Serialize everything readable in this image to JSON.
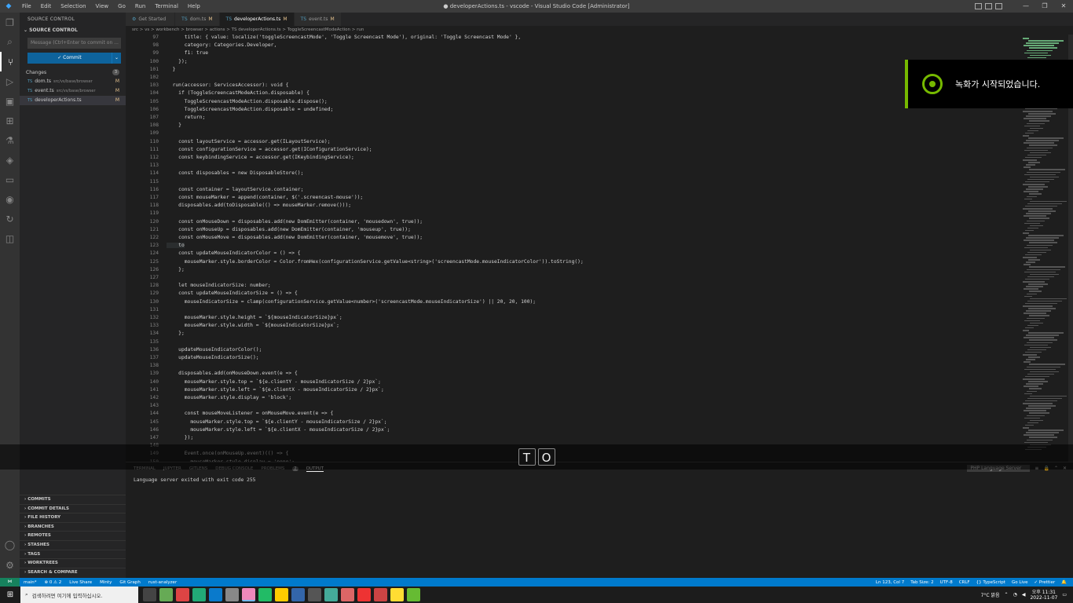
{
  "titlebar": {
    "menu": [
      "File",
      "Edit",
      "Selection",
      "View",
      "Go",
      "Run",
      "Terminal",
      "Help"
    ],
    "title": "● developerActions.ts - vscode - Visual Studio Code [Administrator]",
    "controls": [
      "—",
      "❐",
      "✕"
    ]
  },
  "activity_icons": [
    "files-icon",
    "search-icon",
    "source-control-icon",
    "run-debug-icon",
    "remote-explorer-icon",
    "extensions-icon",
    "testing-icon",
    "python-icon",
    "terminal-icon",
    "gitlens-icon",
    "live-share-icon",
    "browser-icon"
  ],
  "sidebar": {
    "header": "SOURCE CONTROL",
    "section": "SOURCE CONTROL",
    "commit_placeholder": "Message (Ctrl+Enter to commit on ...",
    "commit_label": "✓ Commit",
    "changes_label": "Changes",
    "changes_count": "3",
    "files": [
      {
        "name": "dom.ts",
        "dir": "src/vs/base/browser",
        "status": "M"
      },
      {
        "name": "event.ts",
        "dir": "src/vs/base/browser",
        "status": "M"
      },
      {
        "name": "developerActions.ts",
        "dir": "",
        "status": "M"
      }
    ],
    "gitlens": [
      "COMMITS",
      "COMMIT DETAILS",
      "FILE HISTORY",
      "BRANCHES",
      "REMOTES",
      "STASHES",
      "TAGS",
      "WORKTREES",
      "SEARCH & COMPARE"
    ]
  },
  "tabs": [
    {
      "label": "Get Started",
      "mod": "",
      "icon": "⚙"
    },
    {
      "label": "dom.ts",
      "mod": "M",
      "icon": "TS"
    },
    {
      "label": "developerActions.ts",
      "mod": "M",
      "icon": "TS"
    },
    {
      "label": "event.ts",
      "mod": "M",
      "icon": "TS"
    }
  ],
  "breadcrumb": "src > vs > workbench > browser > actions > TS developerActions.ts > ToggleScreencastModeAction > run",
  "code": [
    {
      "n": "97",
      "t": "      title: { value: localize('toggleScreencastMode', 'Toggle Screencast Mode'), original: 'Toggle Screencast Mode' },"
    },
    {
      "n": "98",
      "t": "      category: Categories.Developer,"
    },
    {
      "n": "99",
      "t": "      f1: true"
    },
    {
      "n": "100",
      "t": "    });"
    },
    {
      "n": "101",
      "t": "  }"
    },
    {
      "n": "102",
      "t": ""
    },
    {
      "n": "103",
      "t": "  run(accessor: ServicesAccessor): void {"
    },
    {
      "n": "104",
      "t": "    if (ToggleScreencastModeAction.disposable) {"
    },
    {
      "n": "105",
      "t": "      ToggleScreencastModeAction.disposable.dispose();"
    },
    {
      "n": "106",
      "t": "      ToggleScreencastModeAction.disposable = undefined;"
    },
    {
      "n": "107",
      "t": "      return;"
    },
    {
      "n": "108",
      "t": "    }"
    },
    {
      "n": "109",
      "t": ""
    },
    {
      "n": "110",
      "t": "    const layoutService = accessor.get(ILayoutService);"
    },
    {
      "n": "111",
      "t": "    const configurationService = accessor.get(IConfigurationService);"
    },
    {
      "n": "112",
      "t": "    const keybindingService = accessor.get(IKeybindingService);"
    },
    {
      "n": "113",
      "t": ""
    },
    {
      "n": "114",
      "t": "    const disposables = new DisposableStore();"
    },
    {
      "n": "115",
      "t": ""
    },
    {
      "n": "116",
      "t": "    const container = layoutService.container;"
    },
    {
      "n": "117",
      "t": "    const mouseMarker = append(container, $('.screencast-mouse'));"
    },
    {
      "n": "118",
      "t": "    disposables.add(toDisposable(() => mouseMarker.remove()));"
    },
    {
      "n": "119",
      "t": ""
    },
    {
      "n": "120",
      "t": "    const onMouseDown = disposables.add(new DomEmitter(container, 'mousedown', true));"
    },
    {
      "n": "121",
      "t": "    const onMouseUp = disposables.add(new DomEmitter(container, 'mouseup', true));"
    },
    {
      "n": "122",
      "t": "    const onMouseMove = disposables.add(new DomEmitter(container, 'mousemove', true));"
    },
    {
      "n": "123",
      "t": "    to"
    },
    {
      "n": "124",
      "t": "    const updateMouseIndicatorColor = () => {"
    },
    {
      "n": "125",
      "t": "      mouseMarker.style.borderColor = Color.fromHex(configurationService.getValue<string>('screencastMode.mouseIndicatorColor')).toString();"
    },
    {
      "n": "126",
      "t": "    };"
    },
    {
      "n": "127",
      "t": ""
    },
    {
      "n": "128",
      "t": "    let mouseIndicatorSize: number;"
    },
    {
      "n": "129",
      "t": "    const updateMouseIndicatorSize = () => {"
    },
    {
      "n": "130",
      "t": "      mouseIndicatorSize = clamp(configurationService.getValue<number>('screencastMode.mouseIndicatorSize') || 20, 20, 100);"
    },
    {
      "n": "131",
      "t": ""
    },
    {
      "n": "132",
      "t": "      mouseMarker.style.height = `${mouseIndicatorSize}px`;"
    },
    {
      "n": "133",
      "t": "      mouseMarker.style.width = `${mouseIndicatorSize}px`;"
    },
    {
      "n": "134",
      "t": "    };"
    },
    {
      "n": "135",
      "t": ""
    },
    {
      "n": "136",
      "t": "    updateMouseIndicatorColor();"
    },
    {
      "n": "137",
      "t": "    updateMouseIndicatorSize();"
    },
    {
      "n": "138",
      "t": ""
    },
    {
      "n": "139",
      "t": "    disposables.add(onMouseDown.event(e => {"
    },
    {
      "n": "140",
      "t": "      mouseMarker.style.top = `${e.clientY - mouseIndicatorSize / 2}px`;"
    },
    {
      "n": "141",
      "t": "      mouseMarker.style.left = `${e.clientX - mouseIndicatorSize / 2}px`;"
    },
    {
      "n": "142",
      "t": "      mouseMarker.style.display = 'block';"
    },
    {
      "n": "143",
      "t": ""
    },
    {
      "n": "144",
      "t": "      const mouseMoveListener = onMouseMove.event(e => {"
    },
    {
      "n": "145",
      "t": "        mouseMarker.style.top = `${e.clientY - mouseIndicatorSize / 2}px`;"
    },
    {
      "n": "146",
      "t": "        mouseMarker.style.left = `${e.clientX - mouseIndicatorSize / 2}px`;"
    },
    {
      "n": "147",
      "t": "      });"
    },
    {
      "n": "148",
      "t": ""
    },
    {
      "n": "149",
      "t": "      Event.once(onMouseUp.event)(() => {"
    },
    {
      "n": "150",
      "t": "        mouseMarker.style.display = 'none';"
    }
  ],
  "keys": [
    "T",
    "O"
  ],
  "panel": {
    "tabs": [
      "TERMINAL",
      "JUPYTER",
      "GITLENS",
      "DEBUG CONSOLE",
      "PROBLEMS",
      "OUTPUT"
    ],
    "problems_count": "2",
    "channel": "PHP Language Server",
    "output_line": "Language server exited with exit code 255"
  },
  "notification": "녹화가 시작되었습니다.",
  "statusbar": {
    "left": [
      "main*",
      "⊗ 0 ⚠ 2",
      "Live Share",
      "Minty",
      "Git Graph",
      "rust-analyzer"
    ],
    "right": [
      "Ln 123, Col 7",
      "Tab Size: 2",
      "UTF-8",
      "CRLF",
      "{} TypeScript",
      "Go Live",
      "✓ Prettier"
    ]
  },
  "taskbar": {
    "search_placeholder": "검색하려면 여기에 입력하십시오.",
    "tray_text": "7°C 맑음",
    "time": "오후 11:31",
    "date": "2022-11-07"
  }
}
